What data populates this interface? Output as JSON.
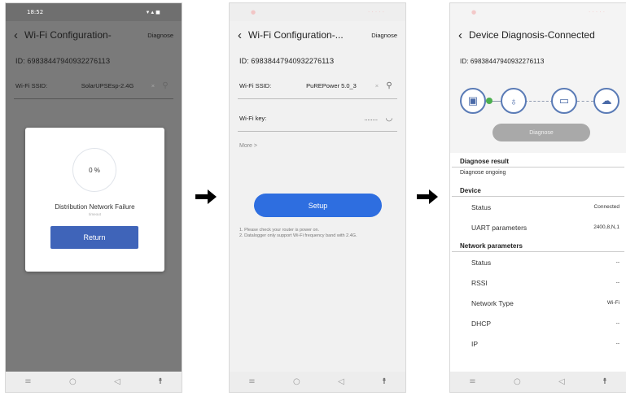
{
  "phone1": {
    "status_time": "18:52",
    "header": {
      "title": "Wi-Fi Configuration-",
      "diagnose": "Diagnose"
    },
    "id_text": "ID: 6983844794093227611З",
    "ssid": {
      "label": "Wi-Fi SSID:",
      "value": "SolarUPSEsp-2.4G"
    },
    "dialog": {
      "progress": "0 %",
      "progress_fraction": 0,
      "title": "Distribution Network Failure",
      "subtitle": "timeout",
      "return_label": "Return"
    }
  },
  "phone2": {
    "header": {
      "title": "Wi-Fi Configuration-...",
      "diagnose": "Diagnose"
    },
    "id_text": "ID: 6983844794093227611З",
    "ssid": {
      "label": "Wi-Fi SSID:",
      "value": "PuREPower 5.0_3"
    },
    "key": {
      "label": "Wi-Fi key:",
      "value": "........"
    },
    "more": "More >",
    "setup_label": "Setup",
    "notes": [
      "1. Please check your router is power on.",
      "2. Datalogger only support Wi-Fi frequency band with 2.4G."
    ]
  },
  "phone3": {
    "header": {
      "title": "Device Diagnosis-Connected"
    },
    "id_text": "ID: 6983844794093227611З",
    "diagnose_label": "Diagnose",
    "diagnose_result": {
      "title": "Diagnose result",
      "value": "Diagnose ongoing"
    },
    "device": {
      "title": "Device",
      "rows": [
        {
          "label": "Status",
          "value": "Connected"
        },
        {
          "label": "UART parameters",
          "value": "2400,8,N,1"
        }
      ]
    },
    "network": {
      "title": "Network parameters",
      "rows": [
        {
          "label": "Status",
          "value": "--"
        },
        {
          "label": "RSSI",
          "value": "--"
        },
        {
          "label": "Network Type",
          "value": "Wi-Fi"
        },
        {
          "label": "DHCP",
          "value": "--"
        },
        {
          "label": "IP",
          "value": "--"
        }
      ]
    }
  },
  "navbar": {
    "menu": "≡",
    "home": "○",
    "back": "◁",
    "extra": "☨"
  },
  "colors": {
    "primary_blue": "#2e6ee0",
    "return_blue": "#3f64b9",
    "connected_green": "#4caf50",
    "arrow": "#000000"
  }
}
